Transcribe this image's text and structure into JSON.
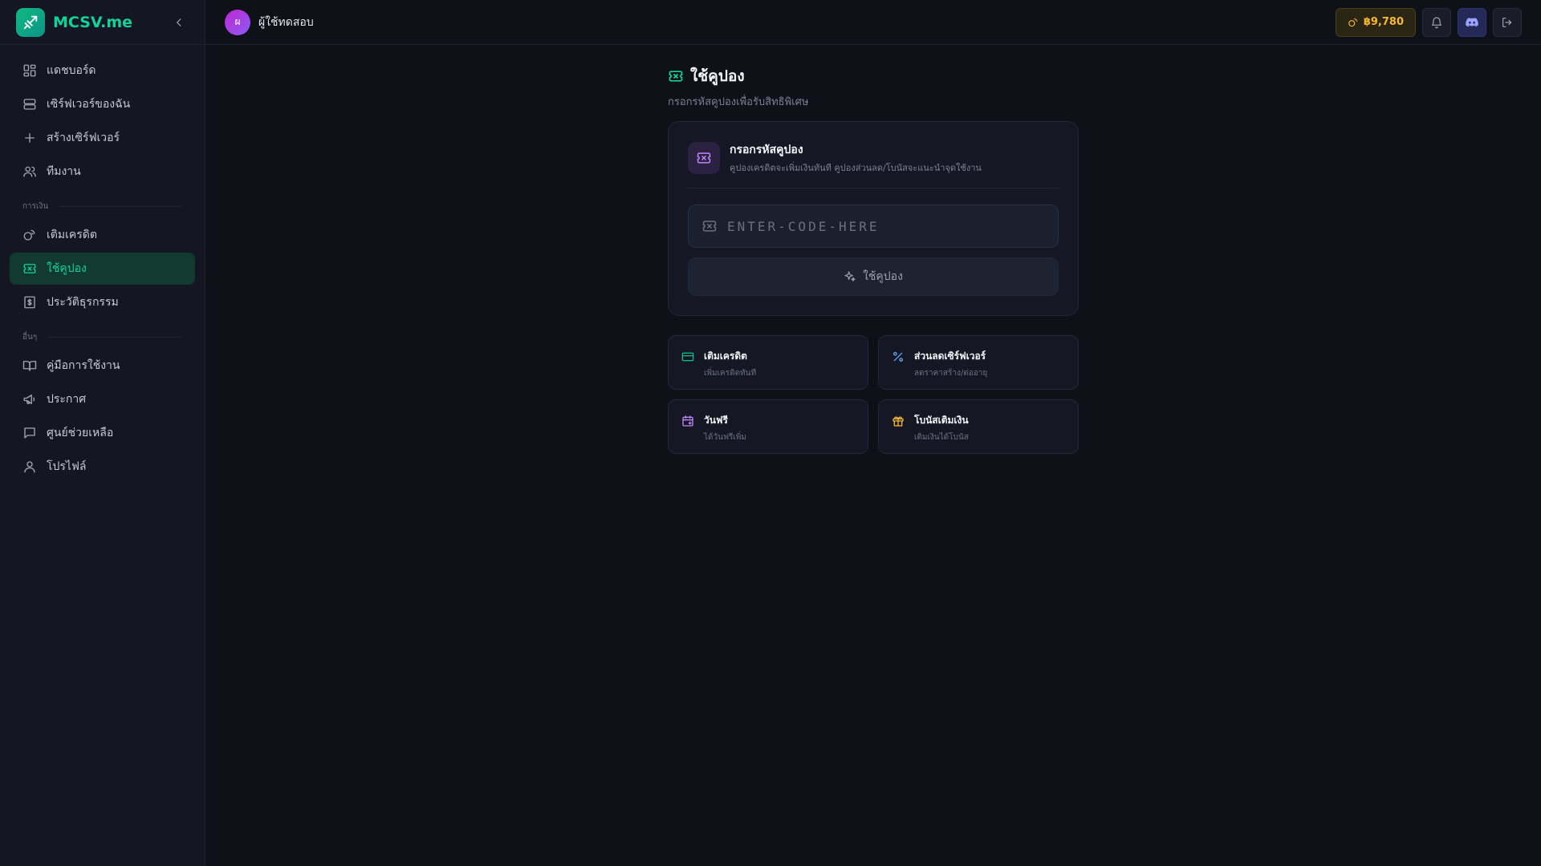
{
  "brand": {
    "name": "MCSV.me"
  },
  "header": {
    "avatar_initial": "ผ",
    "username": "ผู้ใช้ทดสอบ",
    "credit": "฿9,780"
  },
  "sidebar": {
    "items": [
      {
        "label": "แดชบอร์ด",
        "icon": "grid-icon"
      },
      {
        "label": "เซิร์ฟเวอร์ของฉัน",
        "icon": "server-icon"
      },
      {
        "label": "สร้างเซิร์ฟเวอร์",
        "icon": "plus-icon"
      },
      {
        "label": "ทีมงาน",
        "icon": "users-icon"
      }
    ],
    "section_finance": "การเงิน",
    "finance_items": [
      {
        "label": "เติมเครดิต",
        "icon": "coins-icon"
      },
      {
        "label": "ใช้คูปอง",
        "icon": "ticket-icon",
        "active": true
      },
      {
        "label": "ประวัติธุรกรรม",
        "icon": "receipt-icon"
      }
    ],
    "section_other": "อื่นๆ",
    "other_items": [
      {
        "label": "คู่มือการใช้งาน",
        "icon": "book-icon"
      },
      {
        "label": "ประกาศ",
        "icon": "megaphone-icon"
      },
      {
        "label": "ศูนย์ช่วยเหลือ",
        "icon": "message-icon"
      },
      {
        "label": "โปรไฟล์",
        "icon": "user-icon"
      }
    ]
  },
  "page": {
    "title": "ใช้คูปอง",
    "subtitle": "กรอกรหัสคูปองเพื่อรับสิทธิพิเศษ"
  },
  "coupon_card": {
    "title": "กรอกรหัสคูปอง",
    "description": "คูปองเครดิตจะเพิ่มเงินทันที คูปองส่วนลด/โบนัสจะแนะนำจุดใช้งาน",
    "input_placeholder": "ENTER-CODE-HERE",
    "input_value": "",
    "button_label": "ใช้คูปอง"
  },
  "tiles": [
    {
      "title": "เติมเครดิต",
      "desc": "เพิ่มเครดิตทันที",
      "icon": "credit-card-icon",
      "color": "#10b981"
    },
    {
      "title": "ส่วนลดเซิร์ฟเวอร์",
      "desc": "ลดราคาสร้าง/ต่ออายุ",
      "icon": "percent-icon",
      "color": "#60a5fa"
    },
    {
      "title": "วันฟรี",
      "desc": "ได้วันฟรีเพิ่ม",
      "icon": "calendar-icon",
      "color": "#c084fc"
    },
    {
      "title": "โบนัสเติมเงิน",
      "desc": "เติมเงินได้โบนัส",
      "icon": "gift-icon",
      "color": "#f5b82e"
    }
  ],
  "colors": {
    "accent": "#10d39a",
    "gold": "#f5b82e",
    "background": "#0f1119",
    "sidebar": "#141722"
  }
}
